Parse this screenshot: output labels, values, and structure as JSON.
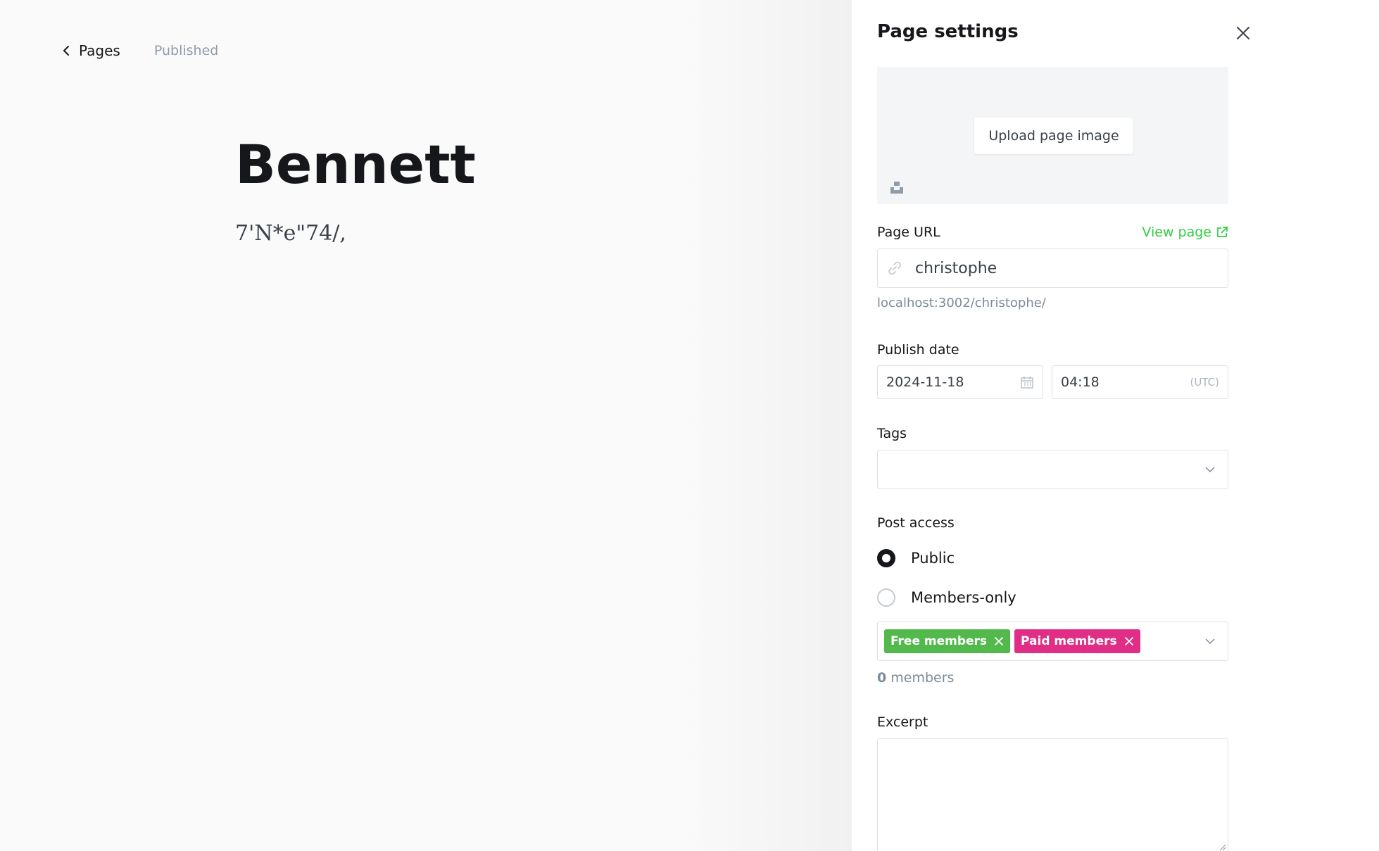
{
  "editor": {
    "back_label": "Pages",
    "status": "Published",
    "title": "Bennett",
    "body": "7'N*e\"74/,"
  },
  "panel": {
    "title": "Page settings",
    "upload_label": "Upload page image",
    "page_url_label": "Page URL",
    "view_page_label": "View page",
    "slug": "christophe",
    "url_hint": "localhost:3002/christophe/",
    "publish_date_label": "Publish date",
    "date": "2024-11-18",
    "time": "04:18",
    "timezone": "(UTC)",
    "tags_label": "Tags",
    "access_label": "Post access",
    "access_options": [
      {
        "label": "Public",
        "checked": true
      },
      {
        "label": "Members-only",
        "checked": false
      }
    ],
    "segments": [
      {
        "label": "Free members",
        "color": "#53b94c"
      },
      {
        "label": "Paid members",
        "color": "#e02d85"
      }
    ],
    "members_count": "0",
    "members_suffix": " members",
    "excerpt_label": "Excerpt",
    "excerpt_value": ""
  },
  "colors": {
    "accent_green": "#30cf43",
    "text_dark": "#15171a",
    "muted": "#7c8b9a"
  },
  "icons": [
    "chevron-left-icon",
    "close-icon",
    "unsplash-icon",
    "external-link-icon",
    "link-icon",
    "calendar-icon",
    "chevron-down-icon",
    "remove-x-icon",
    "resize-grip-icon"
  ]
}
